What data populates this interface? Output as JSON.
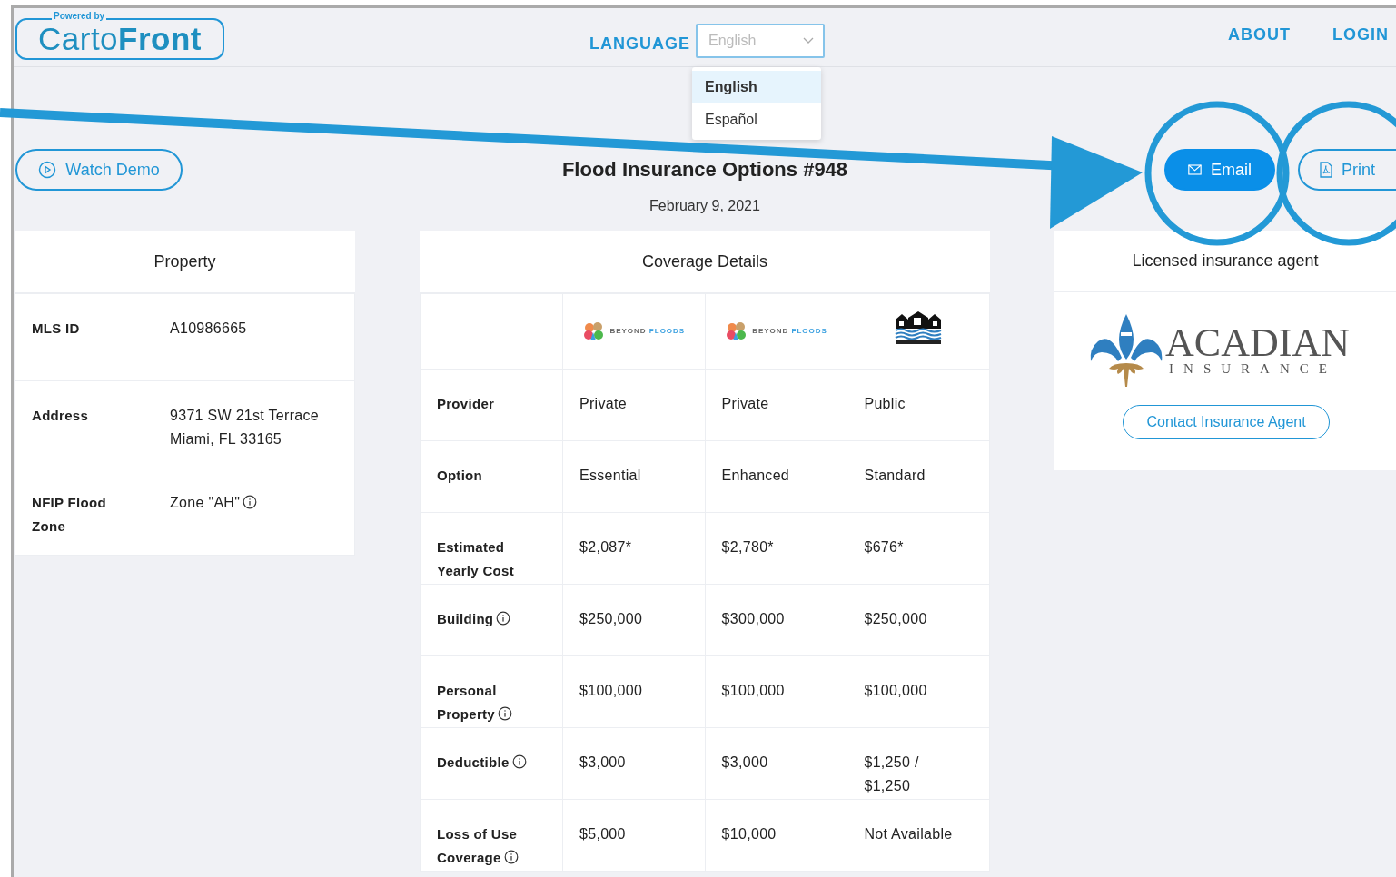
{
  "header": {
    "logo": {
      "tagline": "Powered by",
      "name": "Carto**Front**"
    },
    "language": {
      "label": "LANGUAGE",
      "value": "English",
      "open": true,
      "options": [
        {
          "label": "English",
          "selected": true
        },
        {
          "label": "Español",
          "selected": false
        }
      ]
    },
    "nav": [
      "ABOUT",
      "LOGIN"
    ]
  },
  "toolbar": {
    "demo_button": "Watch Demo",
    "title": "Flood Insurance Options #948",
    "date": "February 9, 2021",
    "actions": [
      {
        "kind": "email",
        "label": "Email",
        "primary": true,
        "highlighted": true
      },
      {
        "kind": "print",
        "label": "Print",
        "primary": false,
        "highlighted": true
      }
    ]
  },
  "property": {
    "title": "Property",
    "rows": [
      {
        "label": "MLS ID",
        "info": false,
        "value": [
          "A10986665"
        ]
      },
      {
        "label": "Address",
        "info": false,
        "value": [
          "9371 SW 21st Terrace",
          "Miami, FL 33165"
        ]
      },
      {
        "label": "NFIP Flood Zone",
        "info": false,
        "value": [
          "Zone \"AH\""
        ],
        "value_info": true
      }
    ]
  },
  "coverage": {
    "title": "Coverage Details",
    "providers": [
      {
        "kind": "beyond",
        "words": [
          "BEYOND",
          "FLOODS"
        ]
      },
      {
        "kind": "beyond",
        "words": [
          "BEYOND",
          "FLOODS"
        ]
      },
      {
        "kind": "nfip"
      }
    ],
    "rows": [
      {
        "label": "Provider",
        "info": false,
        "values": [
          [
            "Private"
          ],
          [
            "Private"
          ],
          [
            "Public"
          ]
        ]
      },
      {
        "label": "Option",
        "info": false,
        "values": [
          [
            "Essential"
          ],
          [
            "Enhanced"
          ],
          [
            "Standard"
          ]
        ]
      },
      {
        "label": "Estimated Yearly Cost",
        "info": false,
        "values": [
          [
            "$2,087*"
          ],
          [
            "$2,780*"
          ],
          [
            "$676*"
          ]
        ]
      },
      {
        "label": "Building",
        "info": true,
        "values": [
          [
            "$250,000"
          ],
          [
            "$300,000"
          ],
          [
            "$250,000"
          ]
        ]
      },
      {
        "label": "Personal Property",
        "info": true,
        "values": [
          [
            "$100,000"
          ],
          [
            "$100,000"
          ],
          [
            "$100,000"
          ]
        ]
      },
      {
        "label": "Deductible",
        "info": true,
        "values": [
          [
            "$3,000"
          ],
          [
            "$3,000"
          ],
          [
            "$1,250 /",
            "$1,250"
          ]
        ]
      },
      {
        "label": "Loss of Use Coverage",
        "info": true,
        "values": [
          [
            "$5,000"
          ],
          [
            "$10,000"
          ],
          [
            "Not Available"
          ]
        ]
      }
    ]
  },
  "agent": {
    "title": "Licensed insurance agent",
    "logo": {
      "name": "ACADIAN",
      "sub": "INSURANCE"
    },
    "button": "Contact Insurance Agent"
  },
  "annotation": {
    "arrow": true
  }
}
